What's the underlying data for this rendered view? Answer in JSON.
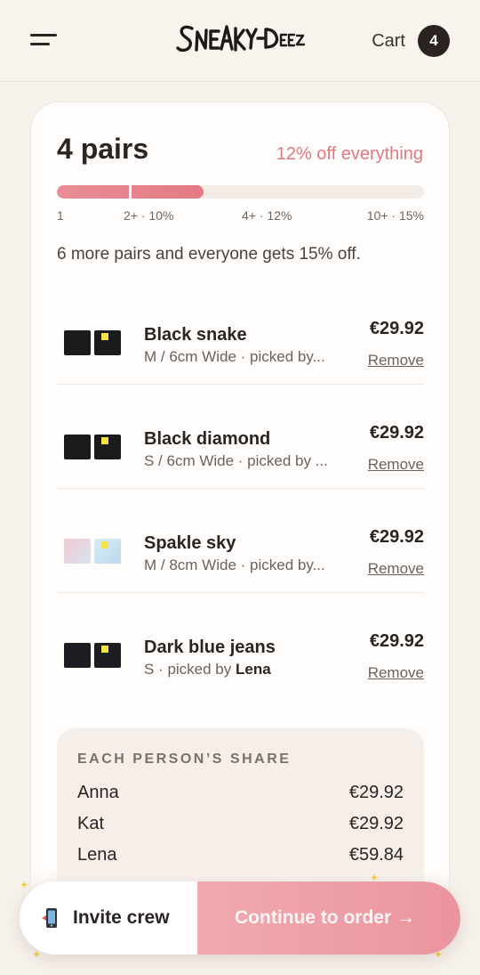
{
  "header": {
    "logo_text": "SNEAKY-DEEZ",
    "cart_label": "Cart",
    "cart_count": "4"
  },
  "summary": {
    "pairs": "4 pairs",
    "discount": "12% off everything",
    "progress_fraction": 0.4,
    "tiers": [
      "1",
      "2+ · 10%",
      "4+ · 12%",
      "10+ · 15%"
    ],
    "hint": "6 more pairs and everyone gets 15% off."
  },
  "items": [
    {
      "name": "Black snake",
      "meta": "M / 6cm Wide · picked by...",
      "meta_prefix": "",
      "picker": "",
      "price": "€29.92",
      "remove": "Remove"
    },
    {
      "name": "Black diamond",
      "meta": "S / 6cm Wide · picked by ...",
      "meta_prefix": "",
      "picker": "",
      "price": "€29.92",
      "remove": "Remove"
    },
    {
      "name": "Spakle sky",
      "meta": "M / 8cm Wide · picked by...",
      "meta_prefix": "",
      "picker": "",
      "price": "€29.92",
      "remove": "Remove"
    },
    {
      "name": "Dark blue jeans",
      "meta": "",
      "meta_prefix": "S · picked by ",
      "picker": "Lena",
      "price": "€29.92",
      "remove": "Remove"
    }
  ],
  "share": {
    "title": "EACH PERSON’S SHARE",
    "rows": [
      {
        "name": "Anna",
        "amount": "€29.92"
      },
      {
        "name": "Kat",
        "amount": "€29.92"
      },
      {
        "name": "Lena",
        "amount": "€59.84"
      }
    ]
  },
  "actions": {
    "invite_label": "Invite crew",
    "continue_label": "Continue to order →"
  },
  "colors": {
    "accent": "#e37a84",
    "button_gradient_start": "#f0aab0",
    "button_gradient_end": "#eb959d",
    "background": "#f7f1ec",
    "dark": "#2b2320"
  },
  "icons": {
    "menu": "hamburger-icon",
    "invite": "phone-icon"
  }
}
